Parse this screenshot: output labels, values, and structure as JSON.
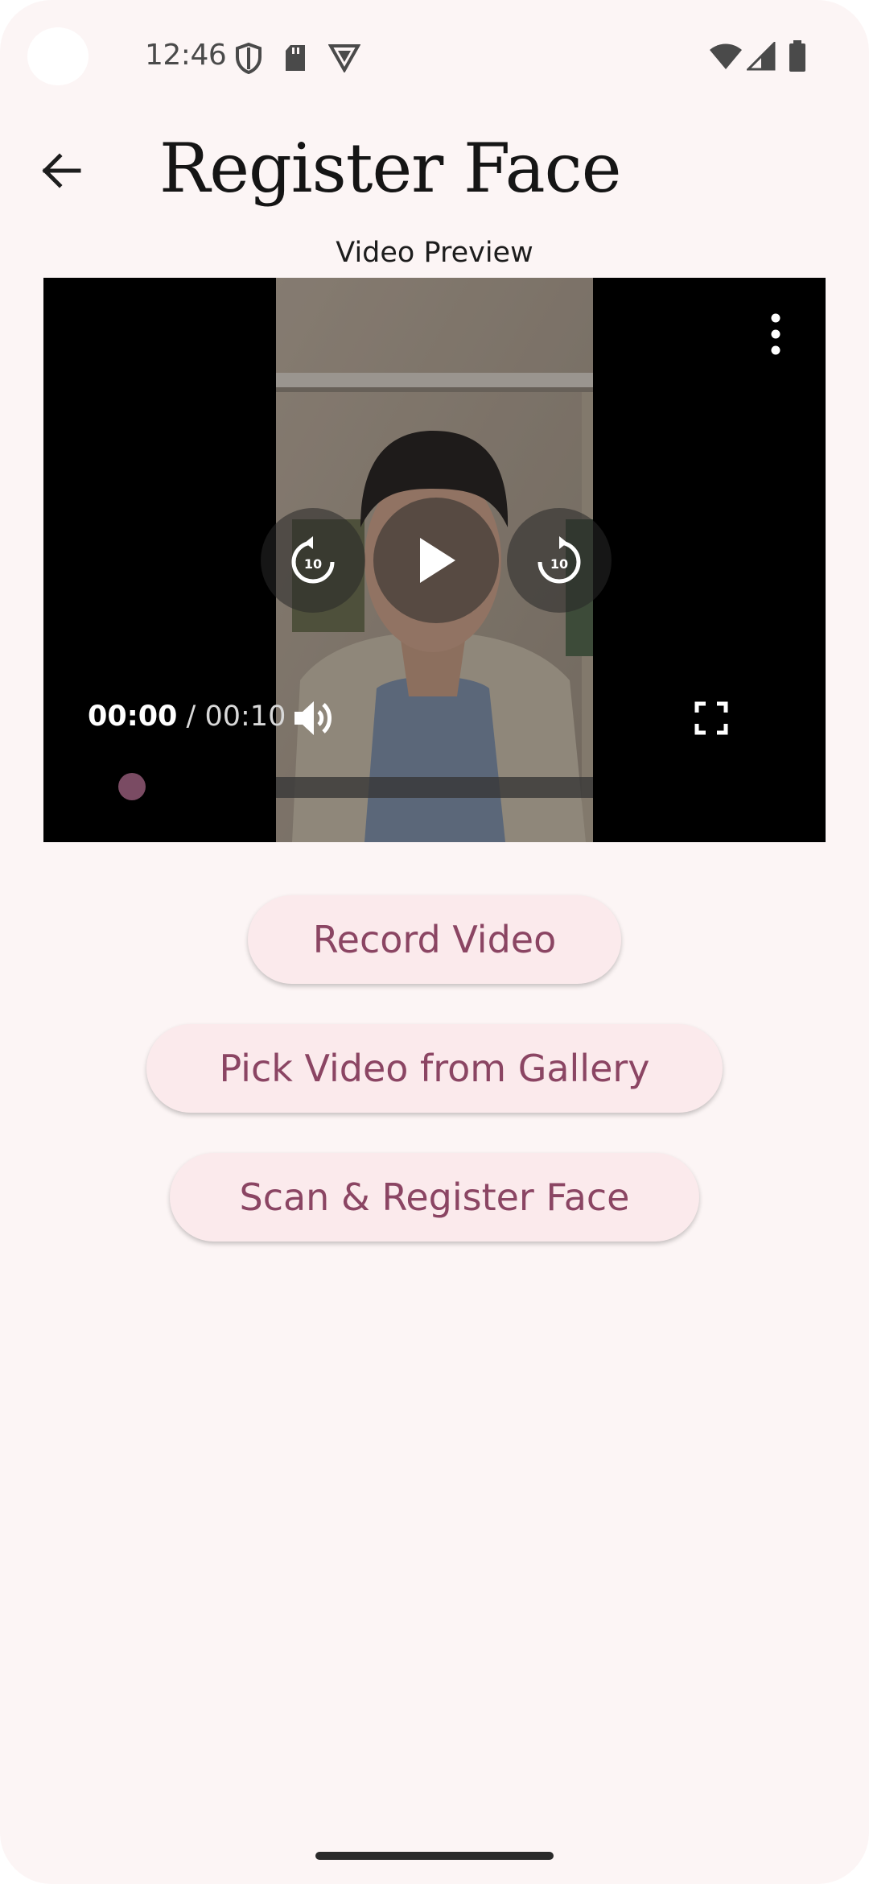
{
  "status_bar": {
    "time": "12:46",
    "icons_left": [
      "shield-icon",
      "sd-card-icon",
      "vpn-shield-icon"
    ],
    "icons_right": [
      "wifi-icon",
      "signal-icon",
      "battery-icon"
    ]
  },
  "app_bar": {
    "back_icon": "arrow-left-icon",
    "title": "Register Face"
  },
  "preview": {
    "label": "Video Preview"
  },
  "player": {
    "current_time": "00:00",
    "separator": " / ",
    "total_time": "00:10",
    "progress": 0,
    "controls": [
      "replay-10-icon",
      "play-icon",
      "forward-10-icon",
      "volume-icon",
      "fullscreen-icon",
      "more-options-icon"
    ],
    "skip_seconds": "10"
  },
  "buttons": {
    "record": "Record Video",
    "pick": "Pick Video from Gallery",
    "scan": "Scan & Register Face"
  },
  "colors": {
    "background": "#fcf5f5",
    "button_bg": "#fbeaec",
    "button_text": "#8b4563",
    "progress_thumb": "#7a4b63"
  }
}
